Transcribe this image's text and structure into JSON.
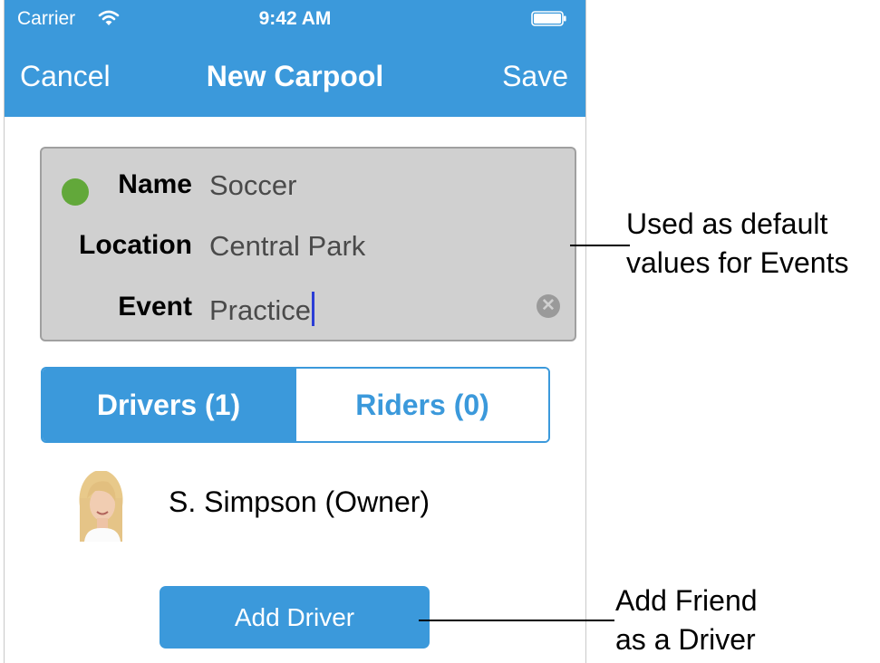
{
  "status_bar": {
    "carrier": "Carrier",
    "time": "9:42 AM"
  },
  "nav": {
    "cancel_label": "Cancel",
    "title": "New Carpool",
    "save_label": "Save"
  },
  "form": {
    "name_label": "Name",
    "name_value": "Soccer",
    "location_label": "Location",
    "location_value": "Central Park",
    "event_label": "Event",
    "event_value": "Practice",
    "color": "#62a83a"
  },
  "segments": {
    "drivers_label": "Drivers (1)",
    "riders_label": "Riders (0)",
    "selected": "drivers"
  },
  "drivers": [
    {
      "name": "S. Simpson (Owner)"
    }
  ],
  "add_driver_label": "Add Driver",
  "annotations": {
    "form_note_line1": "Used as default",
    "form_note_line2": "values for Events",
    "button_note_line1": "Add Friend",
    "button_note_line2": "as a Driver"
  },
  "colors": {
    "accent": "#3b99db",
    "form_bg": "#d0d0d0"
  }
}
